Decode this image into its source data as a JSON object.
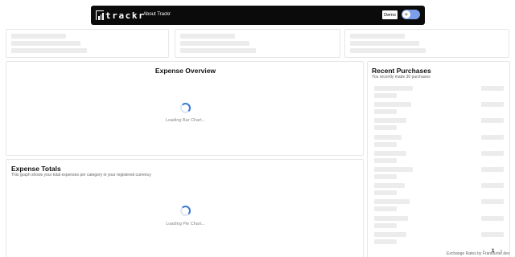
{
  "nav": {
    "logo_text": "trackr",
    "about_label": "About Trackr",
    "demo_label": "Demo",
    "theme_toggle_glyph": "☀"
  },
  "expense_overview": {
    "title": "Expense Overview",
    "loading_text": "Loading Bar Chart..."
  },
  "expense_totals": {
    "title": "Expense Totals",
    "subtitle": "This graph shows your total expenses per category in your registered currency",
    "loading_text": "Loading Pie Chart..."
  },
  "recent_purchases": {
    "title": "Recent Purchases",
    "subtitle": "You recently made 30 purchases"
  },
  "pagination": {
    "current_page": "1",
    "next_glyph": "›"
  },
  "footer": {
    "exchange_rates_text": "Exchange Rates by Frankfurter.dev"
  },
  "colors": {
    "accent": "#3a7bd5",
    "navbar_bg": "#0b0b0b",
    "toggle_bg": "#7b9fe8",
    "skeleton": "#ececec"
  }
}
